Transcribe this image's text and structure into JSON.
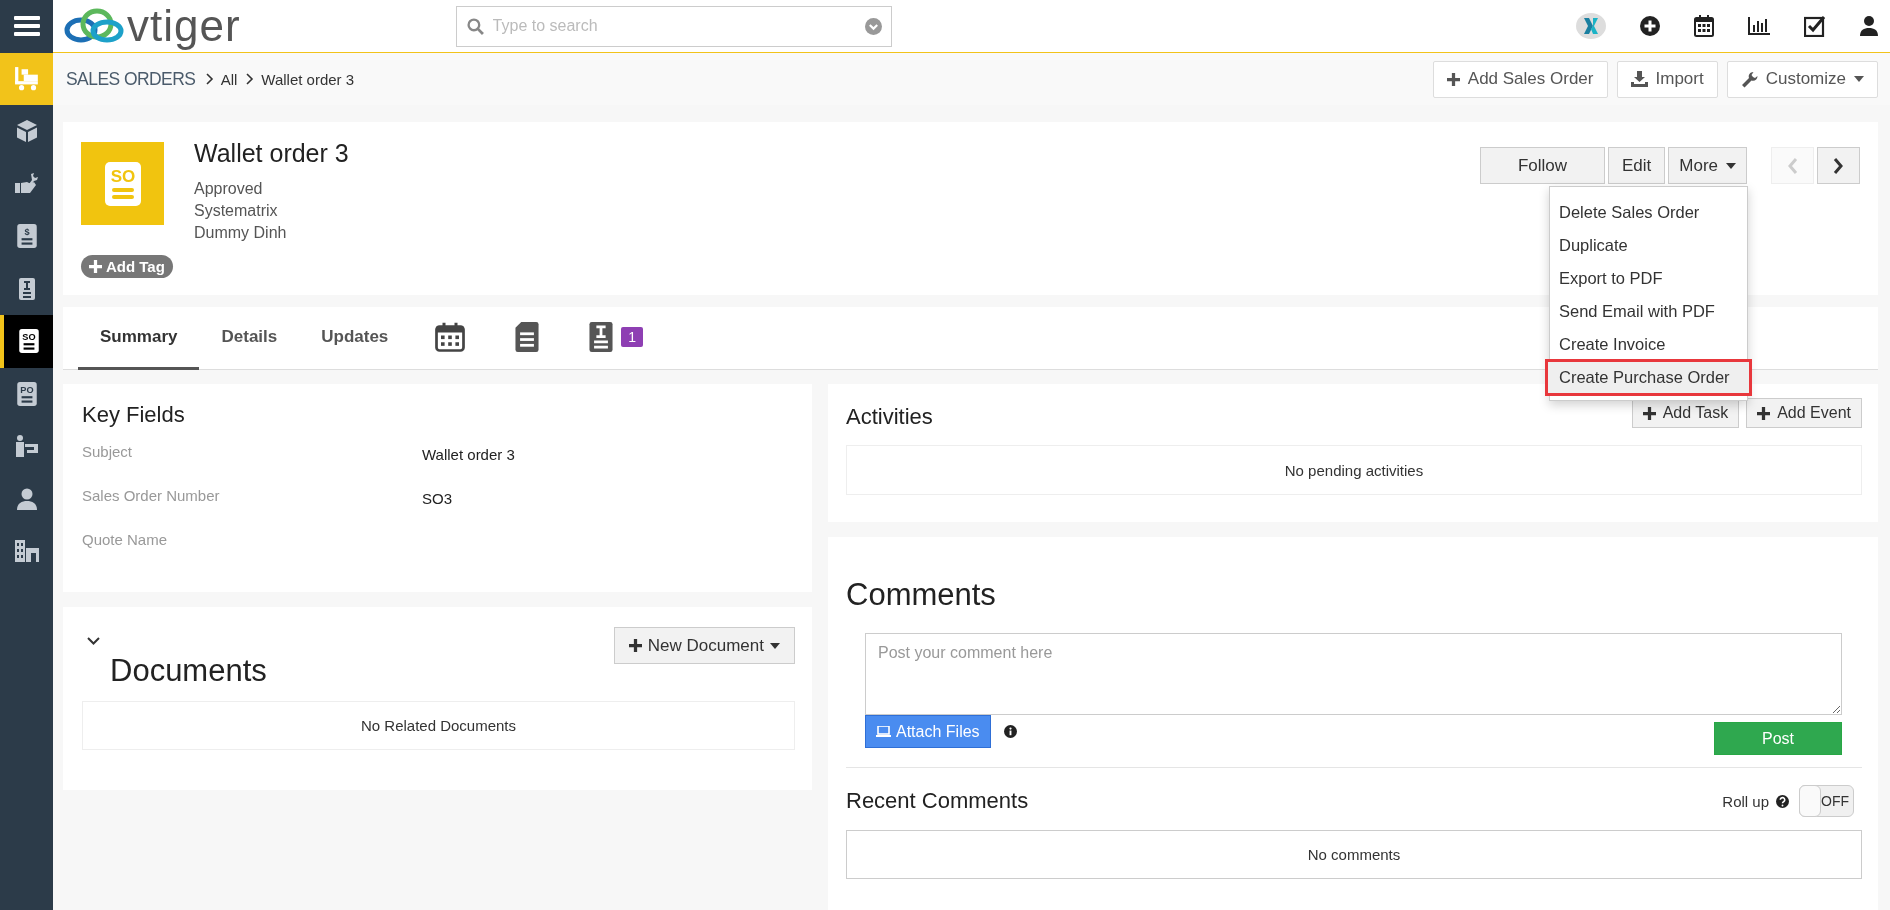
{
  "sidebar": {
    "items": [
      {
        "active": true,
        "selected": false
      },
      {
        "active": false,
        "selected": false
      },
      {
        "active": false,
        "selected": false
      },
      {
        "active": false,
        "selected": false,
        "icon_text": "$"
      },
      {
        "active": false,
        "selected": false
      },
      {
        "active": false,
        "selected": true,
        "icon_text": "SO"
      },
      {
        "active": false,
        "selected": false,
        "icon_text": "PO"
      },
      {
        "active": false,
        "selected": false
      },
      {
        "active": false,
        "selected": false
      },
      {
        "active": false,
        "selected": false
      }
    ]
  },
  "topbar": {
    "logo": "vtiger",
    "search": {
      "placeholder": "Type to search"
    }
  },
  "breadcrumb": {
    "module": "SALES ORDERS",
    "items": [
      "All",
      "Wallet order 3"
    ]
  },
  "page_actions": [
    {
      "kind": "add",
      "label": "Add Sales Order"
    },
    {
      "kind": "import",
      "label": "Import"
    },
    {
      "kind": "customize",
      "label": "Customize"
    }
  ],
  "record": {
    "icon_text": "SO",
    "title": "Wallet order 3",
    "details": [
      "Approved",
      "Systematrix",
      "Dummy Dinh"
    ],
    "add_tag": "Add Tag",
    "actions": [
      {
        "kind": "plain",
        "label": "Follow"
      },
      {
        "kind": "plain",
        "label": "Edit"
      },
      {
        "kind": "dropdown",
        "label": "More"
      }
    ],
    "nav": [
      {
        "kind": "prev",
        "disabled": true
      },
      {
        "kind": "next",
        "disabled": false
      }
    ]
  },
  "more_menu": {
    "items": [
      {
        "label": "Delete Sales Order",
        "highlighted": false
      },
      {
        "label": "Duplicate",
        "highlighted": false
      },
      {
        "label": "Export to PDF",
        "highlighted": false
      },
      {
        "label": "Send Email with PDF",
        "highlighted": false
      },
      {
        "label": "Create Invoice",
        "highlighted": false
      },
      {
        "label": "Create Purchase Order",
        "highlighted": true
      }
    ]
  },
  "tabs": [
    {
      "kind": "text",
      "label": "Summary",
      "selected": true
    },
    {
      "kind": "text",
      "label": "Details",
      "selected": false
    },
    {
      "kind": "text",
      "label": "Updates",
      "selected": false
    },
    {
      "kind": "icon",
      "selected": false
    },
    {
      "kind": "icon",
      "selected": false
    },
    {
      "kind": "icon",
      "selected": false,
      "badge": "1"
    }
  ],
  "key_fields": {
    "title": "Key Fields",
    "rows": [
      {
        "label": "Subject",
        "value": "Wallet order 3"
      },
      {
        "label": "Sales Order Number",
        "value": "SO3"
      },
      {
        "label": "Quote Name"
      }
    ]
  },
  "documents": {
    "title": "Documents",
    "expanded": true,
    "new_button": "New Document",
    "empty": "No Related Documents"
  },
  "activities": {
    "title": "Activities",
    "buttons": [
      "Add Task",
      "Add Event"
    ],
    "empty": "No pending activities"
  },
  "comments": {
    "title": "Comments",
    "input": {
      "placeholder": "Post your comment here"
    },
    "attach": "Attach Files",
    "post": "Post",
    "recent_title": "Recent Comments",
    "rollup": {
      "label": "Roll up",
      "on": false,
      "text": "OFF"
    },
    "empty": "No comments"
  }
}
